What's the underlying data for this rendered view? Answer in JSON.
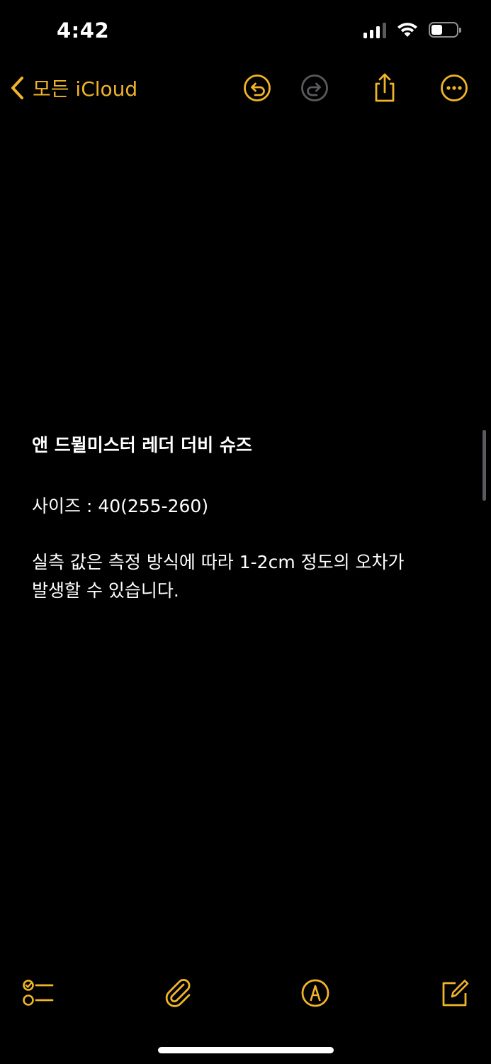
{
  "status_bar": {
    "time": "4:42",
    "signal_icon": "cellular-signal-icon",
    "wifi_icon": "wifi-icon",
    "battery_icon": "battery-icon",
    "battery_level": 0.4
  },
  "nav": {
    "back_label": "모든 iCloud",
    "back_icon": "chevron-left-icon",
    "undo_icon": "undo-icon",
    "redo_icon": "redo-icon",
    "share_icon": "share-icon",
    "more_icon": "ellipsis-circle-icon"
  },
  "note": {
    "title": "앤 드뮐미스터 레더 더비 슈즈",
    "size_line": "사이즈 : 40(255-260)",
    "notice_line_1": "실측 값은 측정 방식에 따라 1-2cm 정도의 오차가",
    "notice_line_2": "발생할 수 있습니다."
  },
  "toolbar": {
    "checklist_icon": "checklist-icon",
    "attachment_icon": "paperclip-icon",
    "markup_icon": "markup-pen-icon",
    "compose_icon": "compose-icon"
  },
  "colors": {
    "accent": "#f0b429",
    "disabled": "#5a5a5e",
    "background": "#000000",
    "text": "#ffffff"
  }
}
